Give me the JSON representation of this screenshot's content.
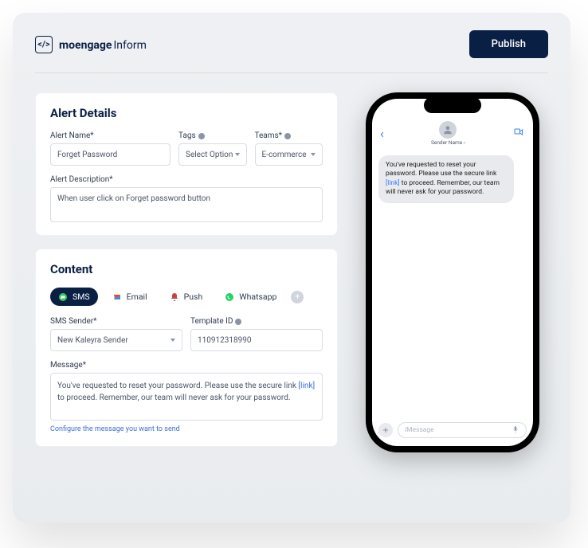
{
  "header": {
    "brand_code": "</>",
    "brand_name": "moengage",
    "brand_sub": "Inform",
    "publish_label": "Publish"
  },
  "alert": {
    "title": "Alert Details",
    "name_label": "Alert Name*",
    "name_value": "Forget Password",
    "tags_label": "Tags",
    "tags_value": "Select Option",
    "teams_label": "Teams*",
    "teams_value": "E-commerce",
    "description_label": "Alert Description*",
    "description_value": "When user click on Forget password button"
  },
  "content": {
    "title": "Content",
    "channels": {
      "sms": "SMS",
      "email": "Email",
      "push": "Push",
      "whatsapp": "Whatsapp"
    },
    "sender_label": "SMS Sender*",
    "sender_value": "New Kaleyra Sender",
    "template_label": "Template ID",
    "template_value": "110912318990",
    "message_label": "Message*",
    "message_pre": "You've requested to reset your password. Please use the secure link ",
    "message_link": "[link]",
    "message_post": " to proceed. Remember, our team will never ask for your password.",
    "configure_note": "Configure the message you want to send"
  },
  "preview": {
    "sender_name": "Sender Name",
    "sender_chevron": "›",
    "bubble_pre": "You've requested to reset your password. Please use the secure link ",
    "bubble_link": "[link]",
    "bubble_post": " to proceed. Remember, our team will never ask for your password.",
    "input_placeholder": "iMessage"
  },
  "colors": {
    "brand_navy": "#0a1f44",
    "link_blue": "#3b6fd6"
  }
}
